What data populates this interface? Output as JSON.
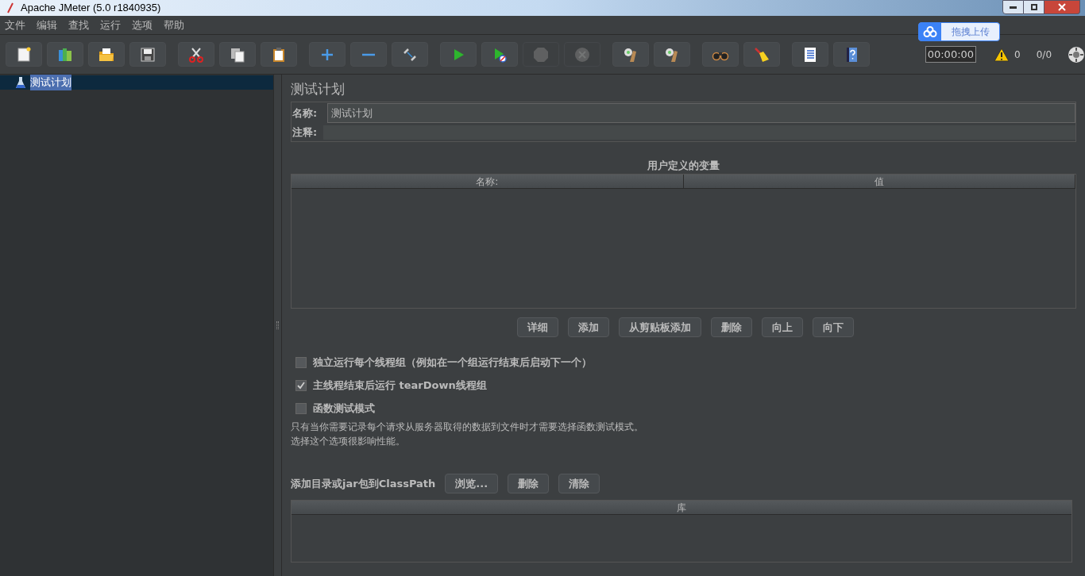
{
  "window": {
    "title": "Apache JMeter (5.0 r1840935)"
  },
  "menu": [
    "文件",
    "编辑",
    "查找",
    "运行",
    "选项",
    "帮助"
  ],
  "toolbar": [
    {
      "disabled": false
    },
    {
      "disabled": false
    },
    {
      "disabled": false
    },
    {
      "disabled": false
    },
    {
      "disabled": false
    },
    {
      "disabled": false
    },
    {
      "disabled": false
    },
    {
      "disabled": false
    },
    {
      "disabled": false
    },
    {
      "disabled": false
    },
    {
      "disabled": false
    },
    {
      "disabled": false
    },
    {
      "disabled": true
    },
    {
      "disabled": true
    },
    {
      "disabled": false
    },
    {
      "disabled": false
    },
    {
      "disabled": false
    },
    {
      "disabled": false
    },
    {
      "disabled": false
    },
    {
      "disabled": false
    }
  ],
  "status": {
    "timer": "00:00:00",
    "warnings": "0",
    "threads": "0/0"
  },
  "upload_badge": "拖拽上传",
  "tree": [
    {
      "label": "测试计划",
      "selected": true
    }
  ],
  "panel": {
    "title": "测试计划",
    "name_label": "名称:",
    "name_value": "测试计划",
    "comment_label": "注释:",
    "variables": {
      "title": "用户定义的变量",
      "columns": [
        "名称:",
        "值"
      ]
    },
    "buttons": [
      "详细",
      "添加",
      "从剪贴板添加",
      "删除",
      "向上",
      "向下"
    ],
    "options": [
      {
        "label": "独立运行每个线程组（例如在一个组运行结束后启动下一个）",
        "checked": false
      },
      {
        "label": "主线程结束后运行 tearDown线程组",
        "checked": true
      },
      {
        "label": "函数测试模式",
        "checked": false
      }
    ],
    "note": [
      "只有当你需要记录每个请求从服务器取得的数据到文件时才需要选择函数测试模式。",
      "选择这个选项很影响性能。"
    ],
    "classpath": {
      "label": "添加目录或jar包到ClassPath",
      "buttons": [
        "浏览...",
        "删除",
        "清除"
      ],
      "columns": [
        "库"
      ]
    }
  }
}
